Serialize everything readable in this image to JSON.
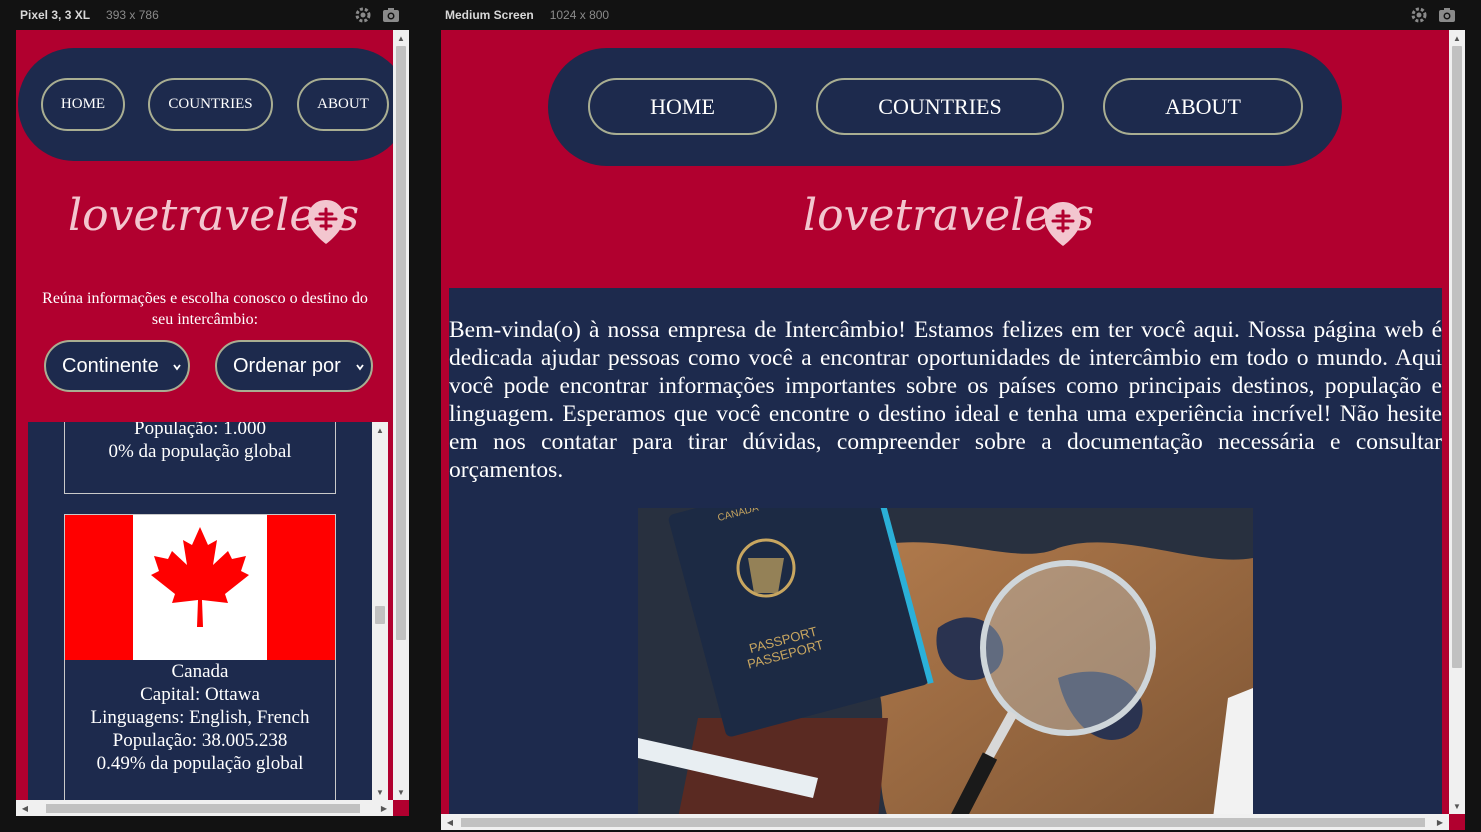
{
  "devices": {
    "mobile": {
      "name": "Pixel 3, 3 XL",
      "dims": "393 x 786"
    },
    "desktop": {
      "name": "Medium Screen",
      "dims": "1024 x 800"
    }
  },
  "nav": {
    "home": "HOME",
    "countries": "COUNTRIES",
    "about": "ABOUT"
  },
  "brand": {
    "logo_text": "lovetravelers"
  },
  "intro": "Reúna informações e escolha conosco o destino do seu intercâmbio:",
  "filters": {
    "continent": "Continente",
    "sort": "Ordenar por"
  },
  "cards": [
    {
      "population": "População: 1.000",
      "share": "0% da população global"
    },
    {
      "name": "Canada",
      "capital": "Capital: Ottawa",
      "languages": "Linguagens: English, French",
      "population": "População: 38.005.238",
      "share": "0.49% da população global"
    }
  ],
  "welcome": "Bem-vinda(o) à nossa empresa de Intercâmbio! Estamos felizes em ter você aqui. Nossa página web é dedicada ajudar pessoas como você a encontrar oportunidades de intercâmbio em todo o mundo. Aqui você pode encontrar informações importantes sobre os países como principais destinos, população e linguagem. Esperamos que você encontre o destino ideal e tenha uma experiência incrível! Não hesite em nos contatar para tirar dúvidas, compreender sobre a documentação necessária e consultar orçamentos.",
  "photo": {
    "passport_text_1": "PASSPORT",
    "passport_text_2": "PASSEPORT",
    "passport_text_3": "CANADA"
  },
  "colors": {
    "brand_red": "#b1002f",
    "navy": "#1d2a4d",
    "border_olive": "#a9ae92"
  },
  "icons": {
    "settings": "gear-icon",
    "screenshot": "camera-icon",
    "logo_pin": "plane-pin-icon",
    "dropdown": "chevron-down-icon"
  }
}
